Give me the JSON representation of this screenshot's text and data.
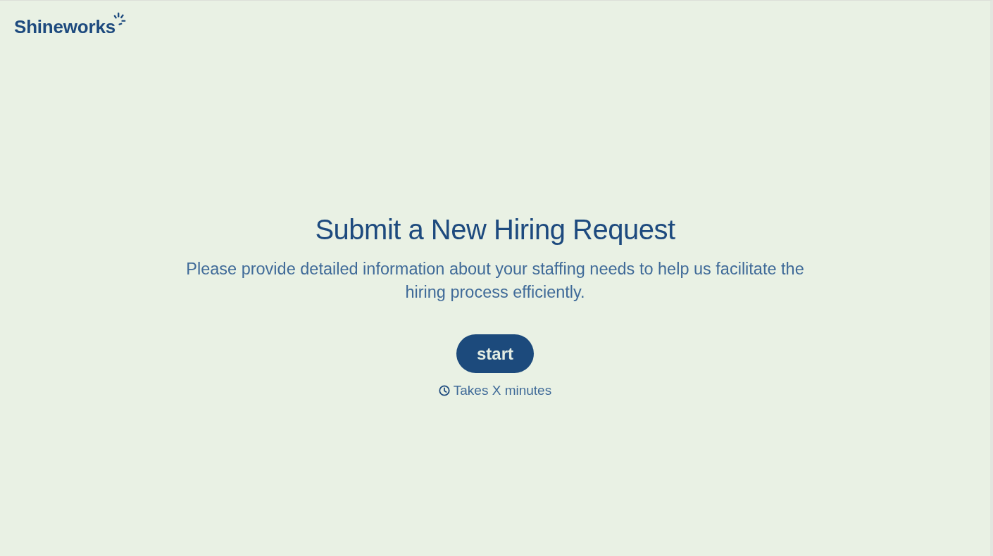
{
  "header": {
    "logo": "Shineworks"
  },
  "hero": {
    "title": "Submit a New Hiring Request",
    "description": "Please provide detailed information about your staffing needs to help us facilitate the hiring process efficiently.",
    "start_button": "start",
    "duration": "Takes X minutes"
  }
}
